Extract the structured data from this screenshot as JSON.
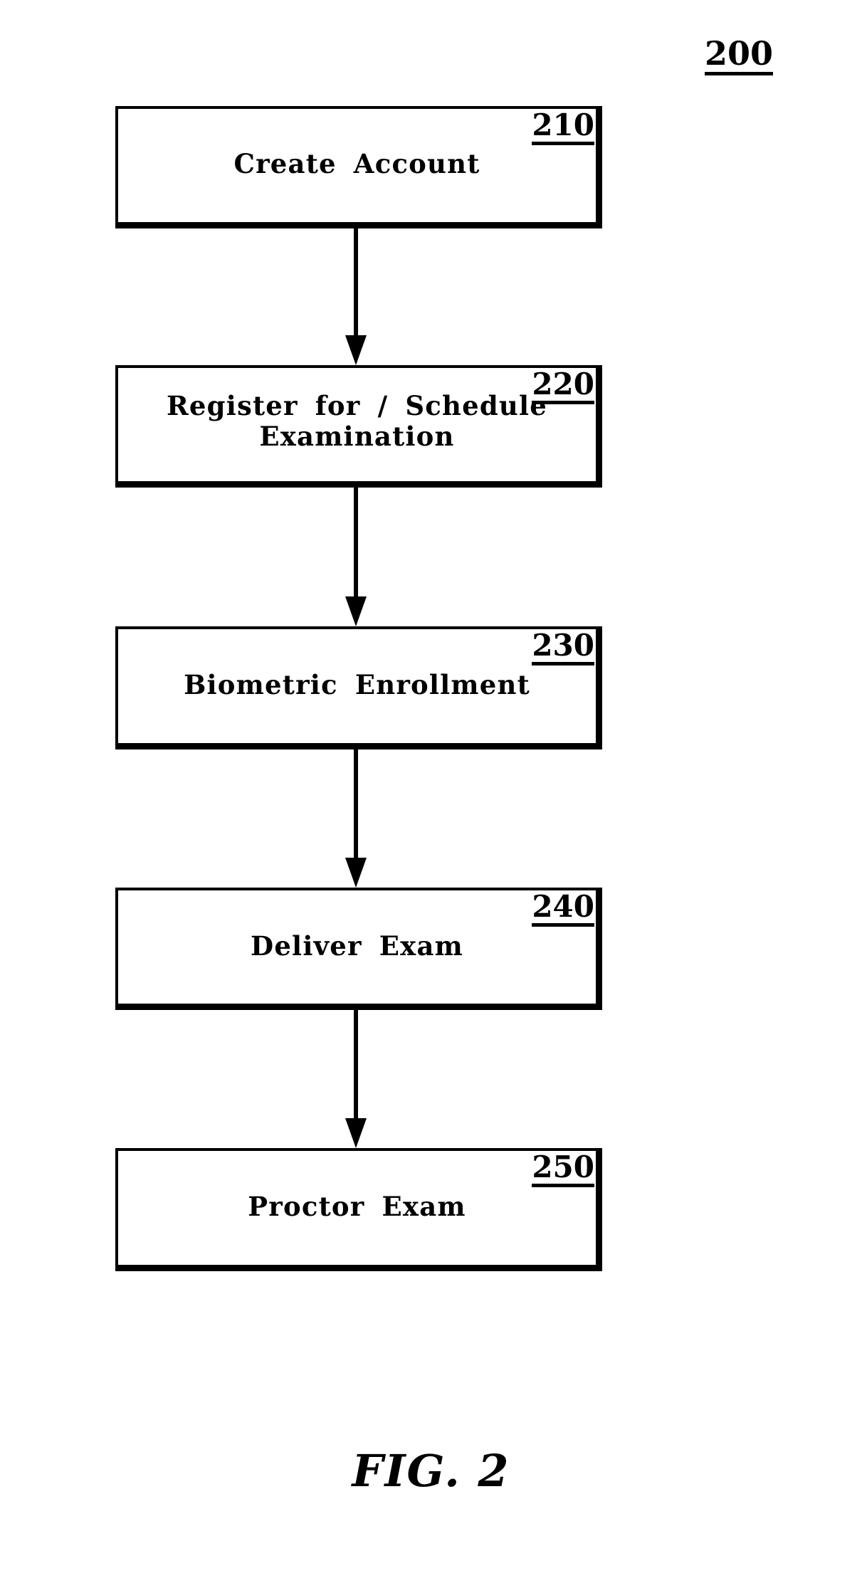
{
  "figure": {
    "reference_numeral": "200",
    "caption": "FIG. 2",
    "ink_color": "#000000",
    "background_color": "#ffffff"
  },
  "flowchart": {
    "type": "vertical-flow",
    "orientation": "top-to-bottom",
    "nodes": [
      {
        "id": "create-account",
        "label": "Create Account",
        "ref": "210"
      },
      {
        "id": "register-schedule",
        "label": "Register for / Schedule\nExamination",
        "ref": "220"
      },
      {
        "id": "biometric-enrollment",
        "label": "Biometric Enrollment",
        "ref": "230"
      },
      {
        "id": "deliver-exam",
        "label": "Deliver Exam",
        "ref": "240"
      },
      {
        "id": "proctor-exam",
        "label": "Proctor Exam",
        "ref": "250"
      }
    ],
    "connectors": [
      {
        "from": "210",
        "to": "220"
      },
      {
        "from": "220",
        "to": "230"
      },
      {
        "from": "230",
        "to": "240"
      },
      {
        "from": "240",
        "to": "250"
      }
    ]
  }
}
